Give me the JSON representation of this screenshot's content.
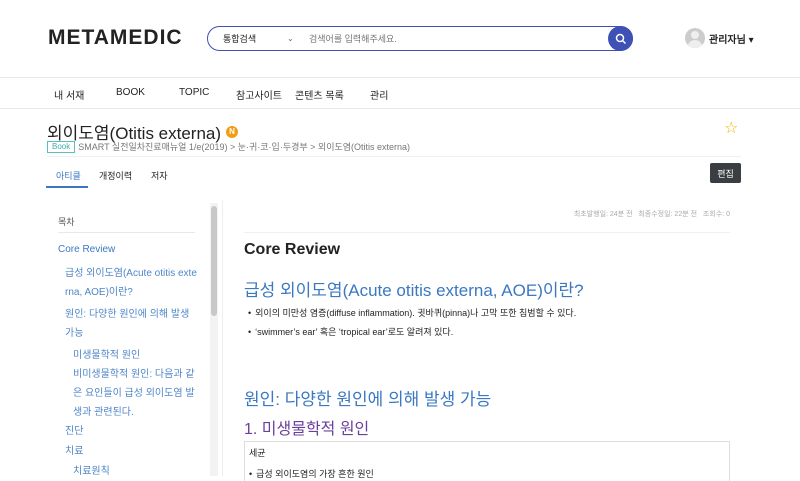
{
  "header": {
    "logo": "METAMEDIC",
    "search_scope": "통합검색",
    "search_placeholder": "검색어를 입력해주세요.",
    "user": "관리자님 ▾"
  },
  "nav": [
    "내 서재",
    "BOOK",
    "TOPIC",
    "참고사이트",
    "콘텐츠 목록",
    "관리"
  ],
  "article": {
    "title": "외이도염(Otitis externa)",
    "badge": "N",
    "book_tag": "Book",
    "breadcrumb": "SMART 실전일차진료매뉴얼 1/e(2019) > 눈·귀·코·입·두경부 > 외이도염(Otitis externa)"
  },
  "tabs": [
    "아티클",
    "개정이력",
    "저자"
  ],
  "edit_label": "편집",
  "toc": {
    "title": "목차",
    "items": [
      "Core Review",
      "급성 외이도염(Acute otitis externa, AOE)이란?",
      "원인: 다양한 원인에 의해 발생 가능",
      "미생물학적 원인",
      "비미생물학적 원인: 다음과 같은 요인들이 급성 외이도염 발생과 관련된다.",
      "진단",
      "치료",
      "치료원칙"
    ]
  },
  "meta": "최초발행일: 24분 전   최종수정일: 22분 전   조회수: 0",
  "content": {
    "h1": "Core Review",
    "h2a": "급성 외이도염(Acute otitis externa, AOE)이란?",
    "bullets": [
      "외이의 미만성 염증(diffuse inflammation). 귓바퀴(pinna)나 고막 또한 침범할 수 있다.",
      "‘swimmer’s ear’ 혹은 ‘tropical ear’로도 알려져 있다."
    ],
    "h2b": "원인: 다양한 원인에 의해 발생 가능",
    "h3": "1. 미생물학적 원인",
    "box_title": "세균",
    "box_bullet": "급성 외이도염의 가장 흔한 원인"
  },
  "colors": {
    "accent": "#3f51b5",
    "link": "#3a78c2",
    "purple": "#6b3fa0"
  }
}
